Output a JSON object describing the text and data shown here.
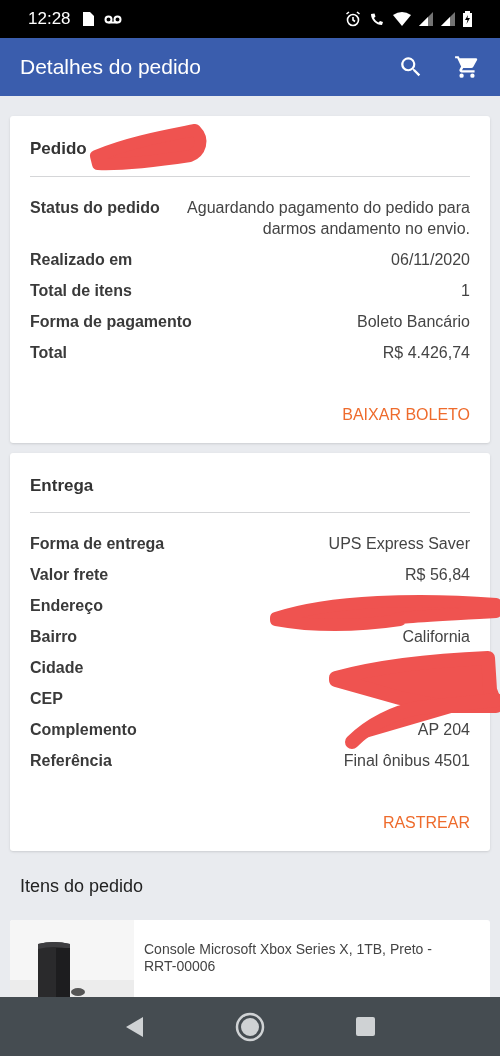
{
  "status_bar": {
    "time": "12:28"
  },
  "app_bar": {
    "title": "Detalhes do pedido"
  },
  "order_card": {
    "title": "Pedido",
    "rows": [
      {
        "label": "Status do pedido",
        "value": "Aguardando pagamento do pedido para darmos andamento no envio."
      },
      {
        "label": "Realizado em",
        "value": "06/11/2020"
      },
      {
        "label": "Total de itens",
        "value": "1"
      },
      {
        "label": "Forma de pagamento",
        "value": "Boleto Bancário"
      },
      {
        "label": "Total",
        "value": "R$ 4.426,74"
      }
    ],
    "action": "BAIXAR BOLETO"
  },
  "delivery_card": {
    "title": "Entrega",
    "rows": [
      {
        "label": "Forma de entrega",
        "value": "UPS Express Saver"
      },
      {
        "label": "Valor frete",
        "value": "R$ 56,84"
      },
      {
        "label": "Endereço"
      },
      {
        "label": "Bairro",
        "value": "California"
      },
      {
        "label": "Cidade"
      },
      {
        "label": "CEP"
      },
      {
        "label": "Complemento",
        "value": "AP 204"
      },
      {
        "label": "Referência",
        "value": "Final ônibus 4501"
      }
    ],
    "action": "RASTREAR"
  },
  "items_section": {
    "title": "Itens do pedido",
    "items": [
      {
        "name": "Console Microsoft Xbox Series X, 1TB, Preto - RRT-00006"
      }
    ]
  }
}
